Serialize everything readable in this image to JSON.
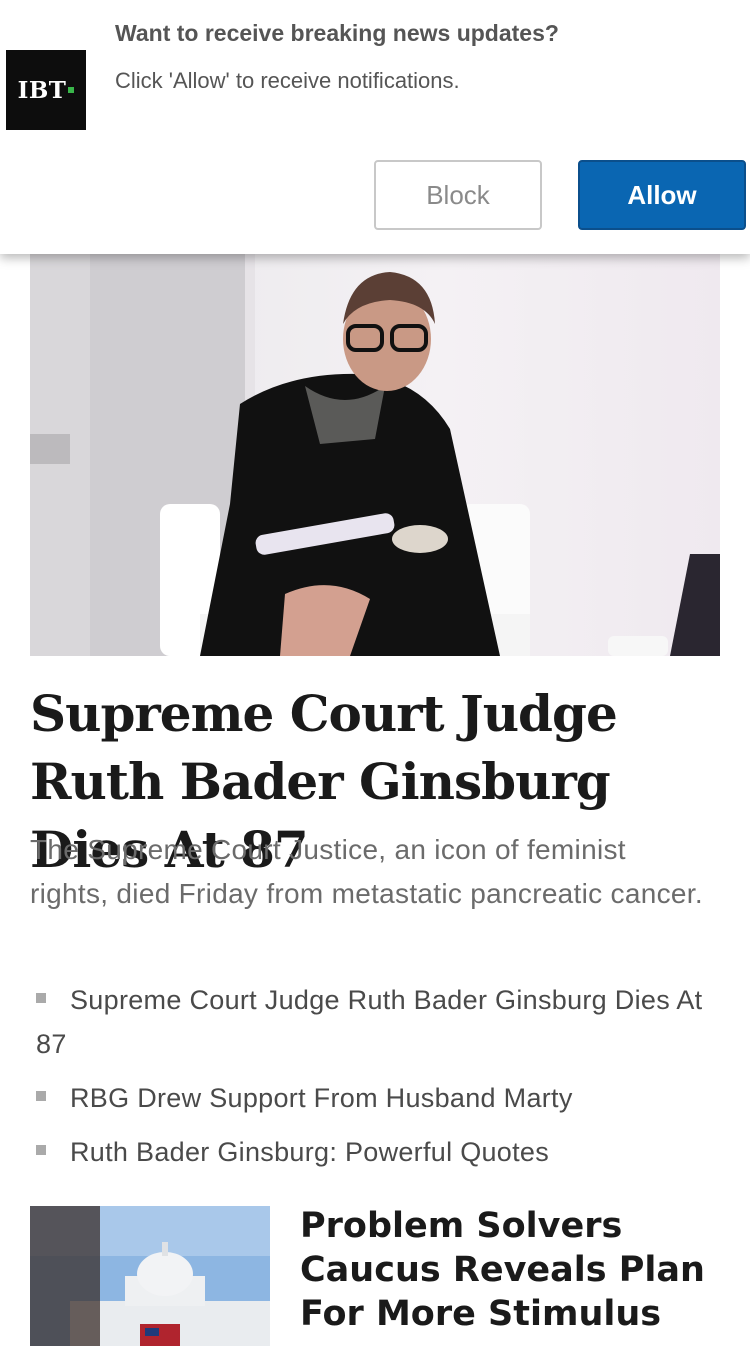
{
  "notification": {
    "brand": "IBT",
    "title": "Want to receive breaking news updates?",
    "body": "Click 'Allow' to receive notifications.",
    "block_label": "Block",
    "allow_label": "Allow",
    "allow_color": "#0a66b2"
  },
  "article": {
    "headline": "Supreme Court Judge Ruth Bader Ginsburg Dies At 87",
    "summary": "The Supreme Court Justice, an icon of feminist rights, died Friday from metastatic pancreatic cancer.",
    "related": [
      "Supreme Court Judge Ruth Bader Ginsburg Dies At 87",
      "RBG Drew Support From Husband Marty",
      "Ruth Bader Ginsburg: Powerful Quotes"
    ]
  },
  "next_story": {
    "title": "Problem Solvers Caucus Reveals Plan For More Stimulus"
  }
}
